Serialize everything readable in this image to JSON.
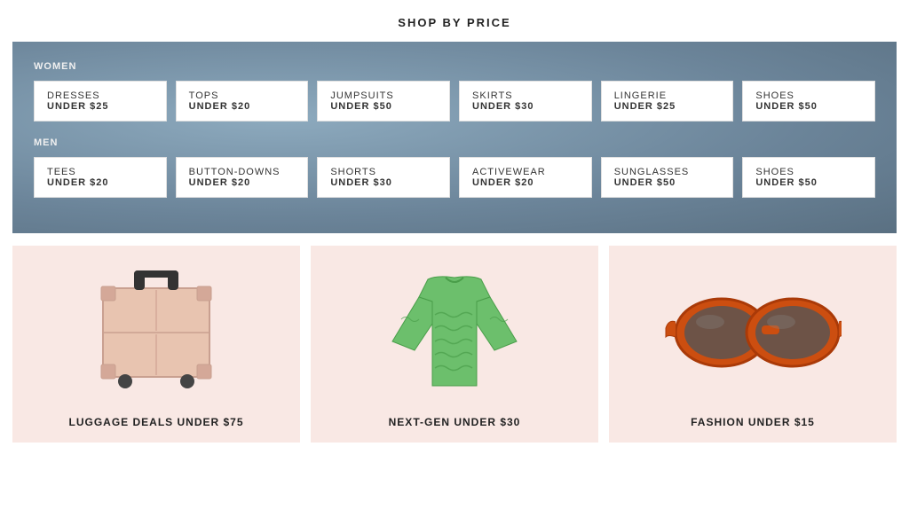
{
  "page": {
    "title": "SHOP BY PRICE"
  },
  "women": {
    "label": "WOMEN",
    "cards": [
      {
        "name": "DRESSES",
        "price": "UNDER $25"
      },
      {
        "name": "TOPS",
        "price": "UNDER $20"
      },
      {
        "name": "JUMPSUITS",
        "price": "UNDER $50"
      },
      {
        "name": "SKIRTS",
        "price": "UNDER $30"
      },
      {
        "name": "LINGERIE",
        "price": "UNDER $25"
      },
      {
        "name": "SHOES",
        "price": "UNDER $50"
      }
    ]
  },
  "men": {
    "label": "MEN",
    "cards": [
      {
        "name": "TEES",
        "price": "UNDER $20"
      },
      {
        "name": "BUTTON-DOWNS",
        "price": "UNDER $20"
      },
      {
        "name": "SHORTS",
        "price": "UNDER $30"
      },
      {
        "name": "ACTIVEWEAR",
        "price": "UNDER $20"
      },
      {
        "name": "SUNGLASSES",
        "price": "UNDER $50"
      },
      {
        "name": "SHOES",
        "price": "UNDER $50"
      }
    ]
  },
  "products": [
    {
      "label": "LUGGAGE DEALS UNDER $75"
    },
    {
      "label": "NEXT-GEN UNDER $30"
    },
    {
      "label": "FASHION UNDER $15"
    }
  ]
}
